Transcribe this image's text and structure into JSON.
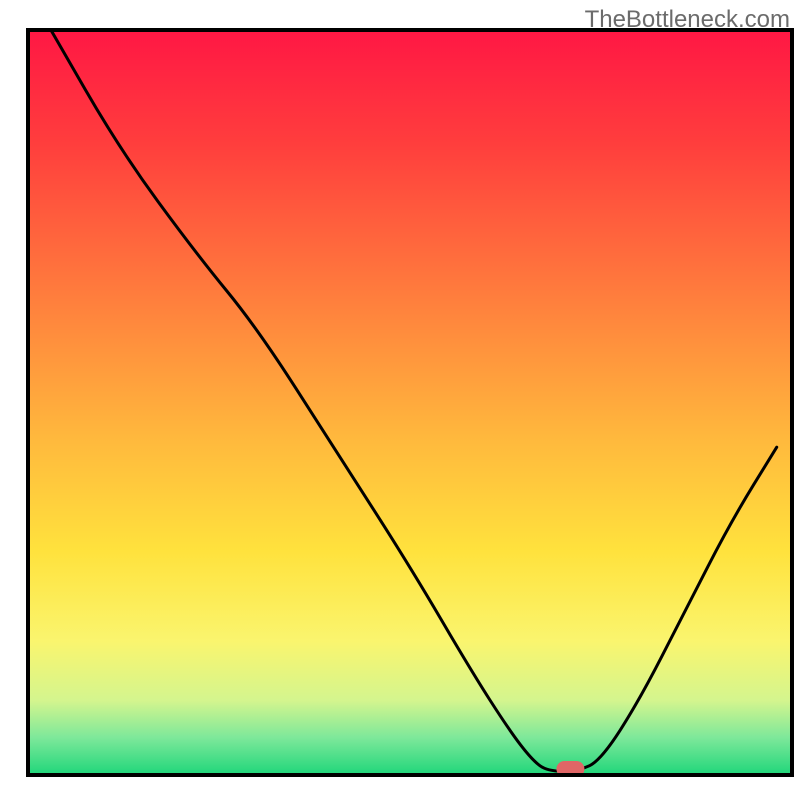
{
  "watermark": "TheBottleneck.com",
  "chart_data": {
    "type": "line",
    "title": "",
    "xlabel": "",
    "ylabel": "",
    "xlim": [
      0,
      100
    ],
    "ylim": [
      0,
      100
    ],
    "background_gradient": [
      {
        "offset": 0,
        "color": "#ff1744"
      },
      {
        "offset": 15,
        "color": "#ff3d3d"
      },
      {
        "offset": 35,
        "color": "#ff7b3d"
      },
      {
        "offset": 55,
        "color": "#ffb93d"
      },
      {
        "offset": 70,
        "color": "#ffe23d"
      },
      {
        "offset": 82,
        "color": "#faf56e"
      },
      {
        "offset": 90,
        "color": "#d4f58e"
      },
      {
        "offset": 95,
        "color": "#7de89a"
      },
      {
        "offset": 100,
        "color": "#1fd67a"
      }
    ],
    "curve": [
      {
        "x": 3,
        "y": 100
      },
      {
        "x": 12,
        "y": 84
      },
      {
        "x": 22,
        "y": 70
      },
      {
        "x": 30,
        "y": 60
      },
      {
        "x": 40,
        "y": 44
      },
      {
        "x": 50,
        "y": 28
      },
      {
        "x": 58,
        "y": 14
      },
      {
        "x": 63,
        "y": 6
      },
      {
        "x": 66,
        "y": 2
      },
      {
        "x": 68,
        "y": 0.5
      },
      {
        "x": 72,
        "y": 0.5
      },
      {
        "x": 75,
        "y": 2
      },
      {
        "x": 80,
        "y": 10
      },
      {
        "x": 86,
        "y": 22
      },
      {
        "x": 92,
        "y": 34
      },
      {
        "x": 98,
        "y": 44
      }
    ],
    "marker": {
      "x": 71,
      "y": 0.8,
      "color": "#e06666"
    },
    "frame_color": "#000000"
  }
}
